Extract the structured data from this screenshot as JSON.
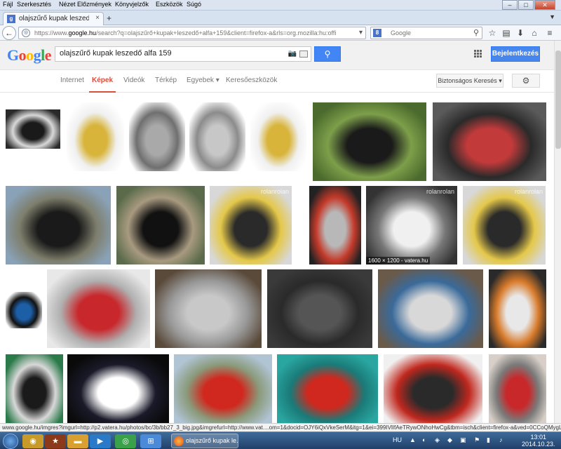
{
  "menu": {
    "items": [
      "Fájl",
      "Szerkesztés",
      "Nézet",
      "Előzmények",
      "Könyvjelzők",
      "Eszközök",
      "Súgó"
    ],
    "window_buttons": [
      "–",
      "□",
      "✕"
    ]
  },
  "tab": {
    "favicon": "g",
    "title": "olajszűrő kupak leszedő alf...",
    "close": "×",
    "new": "+"
  },
  "nav": {
    "back": "←",
    "url_prefix": "https://www.",
    "url_host": "google.hu",
    "url_rest": "/search?q=olajszűrő+kupak+leszedő+alfa+159&client=firefox-a&rls=org.mozilla:hu:official&channel=np&",
    "search_placeholder": "Google",
    "icons": [
      "star-icon",
      "bookmarks-icon",
      "download-icon",
      "home-icon",
      "menu-icon"
    ]
  },
  "google": {
    "logo": [
      {
        "c": "G",
        "color": "#4285f4"
      },
      {
        "c": "o",
        "color": "#ea4335"
      },
      {
        "c": "o",
        "color": "#fbbc05"
      },
      {
        "c": "g",
        "color": "#4285f4"
      },
      {
        "c": "l",
        "color": "#34a853"
      },
      {
        "c": "e",
        "color": "#ea4335"
      }
    ],
    "query": "olajszűrő kupak leszedő alfa 159",
    "signin": "Bejelentkezés",
    "tabs": [
      {
        "label": "Internet",
        "active": false
      },
      {
        "label": "Képek",
        "active": true
      },
      {
        "label": "Videók",
        "active": false
      },
      {
        "label": "Térkép",
        "active": false
      },
      {
        "label": "Egyebek ▾",
        "active": false
      },
      {
        "label": "Keresőeszközök",
        "active": false
      }
    ],
    "safe_search": "Biztonságos Keresés ▾"
  },
  "results": {
    "caption": "1600 × 1200 - vatera.hu",
    "watermark": "rolanrolan",
    "palettes": {
      "tool": [
        "#2a2a2a",
        "#1a1a1a",
        "#d8d8d8"
      ],
      "strap": [
        "#ffffff",
        "#d8b43a",
        "#f0f0f0"
      ],
      "cup": [
        "#ffffff",
        "#a9a9a9",
        "#6f6f6f"
      ],
      "wrench": [
        "#ffffff",
        "#c7c7c7",
        "#8b8b8b"
      ],
      "car_outdoor": [
        "#4b6a2d",
        "#1a1a1a",
        "#7d9f4a"
      ],
      "red_parts": [
        "#5a5a5a",
        "#c23a3a",
        "#2a2a2a"
      ],
      "car_parking": [
        "#8aa2b8",
        "#1a1a1a",
        "#7e7e6c"
      ],
      "car_wedding": [
        "#5a6a4a",
        "#111111",
        "#a89a80"
      ],
      "switch": [
        "#d8d8d8",
        "#2a2a2a",
        "#e4c84a"
      ],
      "lighter": [
        "#222222",
        "#b8b8b8",
        "#c43a2a"
      ],
      "sticker": [
        "#333333",
        "#f0f0f0",
        "#777777"
      ],
      "sockets": [
        "#ffffff",
        "#1d5fa6",
        "#111111"
      ],
      "trim_tools": [
        "#e8e8e8",
        "#c8272b",
        "#b0b0b0"
      ],
      "wheel_bolt": [
        "#5a4a3a",
        "#c8c8c8",
        "#999999"
      ],
      "trunk": [
        "#3a3a3a",
        "#555555",
        "#2a2a2a"
      ],
      "fusebox": [
        "#6a5a4a",
        "#d8d8d8",
        "#3a6a9a"
      ],
      "connector": [
        "#2a2a2a",
        "#e8e8e8",
        "#d87a2a"
      ],
      "socket_set": [
        "#2a7a4a",
        "#1a1a1a",
        "#d8d8d8"
      ],
      "night": [
        "#0a0a0a",
        "#ffffff",
        "#1a1a2a"
      ],
      "car_red": [
        "#b0c4d4",
        "#d0281e",
        "#8a9a7a"
      ],
      "springs": [
        "#2aa6a0",
        "#d0281e",
        "#1a7a78"
      ],
      "light_bar": [
        "#f0f0f0",
        "#2a2a2a",
        "#c0281e"
      ],
      "brake": [
        "#d8d0c8",
        "#c8282a",
        "#7a7a7a"
      ]
    },
    "rows": [
      [
        {
          "id": "r1c1",
          "p": "tool"
        },
        {
          "id": "r1c2",
          "p": "strap"
        },
        {
          "id": "r1c3",
          "p": "cup"
        },
        {
          "id": "r1c4",
          "p": "wrench"
        },
        {
          "id": "r1c5",
          "p": "strap"
        },
        {
          "id": "r1c6",
          "p": "car_outdoor"
        },
        {
          "id": "r1c7",
          "p": "red_parts"
        }
      ],
      [
        {
          "id": "r2c1",
          "p": "car_parking"
        },
        {
          "id": "r2c2",
          "p": "car_wedding"
        },
        {
          "id": "r2c3",
          "p": "switch",
          "wm": true
        },
        {
          "id": "r2c4",
          "p": "lighter"
        },
        {
          "id": "r2c5",
          "p": "sticker",
          "wm": true,
          "cap": true
        },
        {
          "id": "r2c6",
          "p": "switch",
          "wm": true
        }
      ],
      [
        {
          "id": "r3c1",
          "p": "sockets"
        },
        {
          "id": "r3c2",
          "p": "trim_tools"
        },
        {
          "id": "r3c3",
          "p": "wheel_bolt"
        },
        {
          "id": "r3c4",
          "p": "trunk"
        },
        {
          "id": "r3c5",
          "p": "fusebox"
        },
        {
          "id": "r3c6",
          "p": "connector"
        }
      ],
      [
        {
          "id": "r4c1",
          "p": "socket_set"
        },
        {
          "id": "r4c2",
          "p": "night"
        },
        {
          "id": "r4c3",
          "p": "car_red"
        },
        {
          "id": "r4c4",
          "p": "springs"
        },
        {
          "id": "r4c5",
          "p": "light_bar"
        },
        {
          "id": "r4c6",
          "p": "brake"
        }
      ]
    ]
  },
  "status": "www.google.hu/imgres?imgurl=http://p2.vatera.hu/photos/bc/3b/bb27_3_big.jpg&imgrefurl=http://www.vat....om=1&docid=OJY6iQxVkeSerM&itg=1&ei=399IVlIfAeTRywONhoHwCg&tbm=isch&client=firefox-a&ved=0CCoQMygLMAs",
  "taskbar": {
    "task_title": "olajszűrő kupak le...",
    "lang": "HU",
    "time": "13:01",
    "date": "2014.10.23."
  }
}
